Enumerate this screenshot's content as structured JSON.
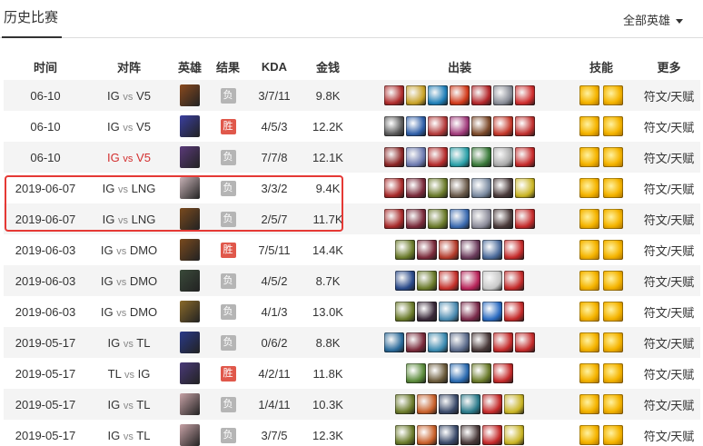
{
  "header": {
    "title": "历史比赛",
    "filter_label": "全部英雄"
  },
  "columns": [
    "时间",
    "对阵",
    "英雄",
    "结果",
    "KDA",
    "金钱",
    "出装",
    "技能",
    "更多"
  ],
  "vs_word": "vs",
  "colors": {
    "win": "#e0584b",
    "loss": "#b5b5b5",
    "highlight": "#e53935"
  },
  "matches": [
    {
      "date": "06-10",
      "team1": "IG",
      "team2": "V5",
      "highlighted": false,
      "hero_color": "#8a4a1e",
      "result": "负",
      "win": false,
      "kda": "3/7/11",
      "gold": "9.8K",
      "items": [
        "#b02c2c",
        "#c9a227",
        "#1f7fb8",
        "#d23a1a",
        "#b3262a",
        "#888c96",
        "#cf2d2d"
      ]
    },
    {
      "date": "06-10",
      "team1": "IG",
      "team2": "V5",
      "highlighted": false,
      "hero_color": "#3a3fa0",
      "result": "胜",
      "win": true,
      "kda": "4/5/3",
      "gold": "12.2K",
      "items": [
        "#5a5a5a",
        "#2f5fa8",
        "#b33a3a",
        "#a03a7a",
        "#7c4a2a",
        "#c4382a",
        "#c0302e"
      ]
    },
    {
      "date": "06-10",
      "team1": "IG",
      "team2": "V5",
      "highlighted": true,
      "hero_color": "#5a3a7a",
      "result": "负",
      "win": false,
      "kda": "7/7/8",
      "gold": "12.1K",
      "items": [
        "#8c2626",
        "#6c7ab0",
        "#b52b2b",
        "#2aa0a8",
        "#3a7a3a",
        "#aaaaaa",
        "#c72a2a"
      ]
    },
    {
      "date": "2019-06-07",
      "team1": "IG",
      "team2": "LNG",
      "highlighted": false,
      "hero_color": "#c7b2b6",
      "result": "负",
      "win": false,
      "kda": "3/3/2",
      "gold": "9.4K",
      "items": [
        "#a82a2a",
        "#7a2a3a",
        "#6a7a2a",
        "#6a5a4a",
        "#7a8aa0",
        "#4a3a3a",
        "#c9b424"
      ]
    },
    {
      "date": "2019-06-07",
      "team1": "IG",
      "team2": "LNG",
      "highlighted": false,
      "hero_color": "#7a4a1e",
      "result": "负",
      "win": false,
      "kda": "2/5/7",
      "gold": "11.7K",
      "items": [
        "#a82a2a",
        "#7a2a3a",
        "#6a7a2a",
        "#3a6ab0",
        "#8c8c9a",
        "#4a3a3a",
        "#c42a2a"
      ]
    },
    {
      "date": "2019-06-03",
      "team1": "IG",
      "team2": "DMO",
      "highlighted": false,
      "hero_color": "#7a4a1e",
      "result": "胜",
      "win": true,
      "kda": "7/5/11",
      "gold": "14.4K",
      "items": [
        "#6a7a2a",
        "#7a2a3a",
        "#b33a2a",
        "#6a3a5a",
        "#4a6a9a",
        "#c42a2a"
      ]
    },
    {
      "date": "2019-06-03",
      "team1": "IG",
      "team2": "DMO",
      "highlighted": false,
      "hero_color": "#3a4a3a",
      "result": "负",
      "win": false,
      "kda": "4/5/2",
      "gold": "8.7K",
      "items": [
        "#2a4a8a",
        "#6a7a2a",
        "#c4302a",
        "#b8245a",
        "#c8c8c8",
        "#c42a2a"
      ]
    },
    {
      "date": "2019-06-03",
      "team1": "IG",
      "team2": "DMO",
      "highlighted": false,
      "hero_color": "#8a6a2a",
      "result": "负",
      "win": false,
      "kda": "4/1/3",
      "gold": "13.0K",
      "items": [
        "#6a7a2a",
        "#3a2a3a",
        "#4a8ab0",
        "#7a2a4a",
        "#2a6ac0",
        "#c42a2a"
      ]
    },
    {
      "date": "2019-05-17",
      "team1": "IG",
      "team2": "TL",
      "highlighted": false,
      "hero_color": "#2a3a8a",
      "result": "负",
      "win": false,
      "kda": "0/6/2",
      "gold": "8.8K",
      "items": [
        "#2a6a9a",
        "#7a2a3a",
        "#3a8ab0",
        "#5a6a8a",
        "#4a3a3a",
        "#c42a2a",
        "#c42a2a"
      ]
    },
    {
      "date": "2019-05-17",
      "team1": "TL",
      "team2": "IG",
      "highlighted": false,
      "hero_color": "#4a3a7a",
      "result": "胜",
      "win": true,
      "kda": "4/2/11",
      "gold": "11.8K",
      "items": [
        "#5a8a3a",
        "#6a5a3a",
        "#2a6ab0",
        "#6a7a2a",
        "#c42a2a"
      ]
    },
    {
      "date": "2019-05-17",
      "team1": "IG",
      "team2": "TL",
      "highlighted": false,
      "hero_color": "#c7a2a6",
      "result": "负",
      "win": false,
      "kda": "1/4/11",
      "gold": "10.3K",
      "items": [
        "#6a7a2a",
        "#c8602a",
        "#3a4a6a",
        "#2a7a8a",
        "#c42a2a",
        "#c9b424"
      ]
    },
    {
      "date": "2019-05-17",
      "team1": "IG",
      "team2": "TL",
      "highlighted": false,
      "hero_color": "#c7a2a6",
      "result": "负",
      "win": false,
      "kda": "3/7/5",
      "gold": "12.3K",
      "items": [
        "#6a7a2a",
        "#c8602a",
        "#3a4a6a",
        "#4a3a3a",
        "#c42a2a",
        "#c9b424"
      ]
    }
  ],
  "skills": [
    "flash-icon",
    "ignite-icon"
  ],
  "more_label": "符文/天赋"
}
